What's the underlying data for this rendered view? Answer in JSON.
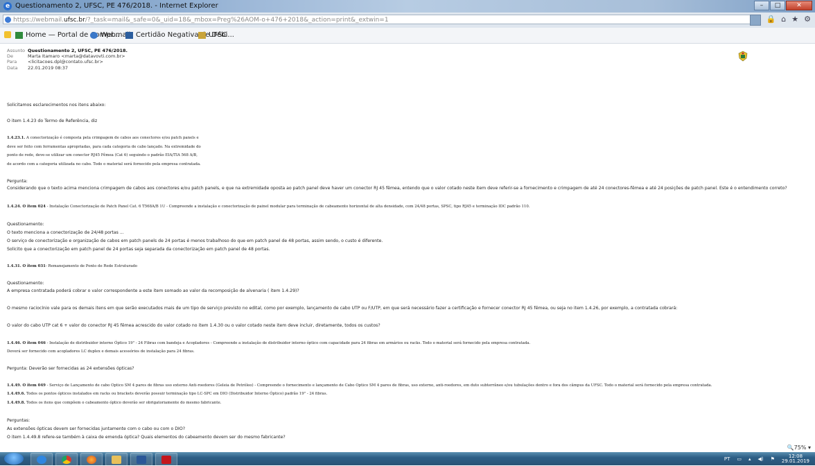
{
  "window": {
    "title": "Questionamento 2, UFSC, PE 476/2018. - Internet Explorer"
  },
  "address": {
    "scheme": "https://webmail.",
    "host": "ufsc.br",
    "rest": "/?_task=mail&_safe=0&_uid=18&_mbox=Preg%26AOM-o+476+2018&_action=print&_extwin=1"
  },
  "favorites": [
    {
      "label": "Home — Portal de Compr...",
      "icon": "portal-icon"
    },
    {
      "label": "Webmail",
      "icon": "webmail-icon"
    },
    {
      "label": "Certidão Negativa de Débi...",
      "icon": "certidao-icon"
    },
    {
      "label": "UFSC",
      "icon": "ufsc-icon"
    }
  ],
  "email": {
    "labels": {
      "subject": "Assunto",
      "from": "De",
      "to": "Para",
      "date": "Data"
    },
    "subject": "Questionamento 2, UFSC, PE 476/2018.",
    "from": "Marta Itamaro <marta@datavovti.com.br>",
    "to": "<licitacoes.dpl@contato.ufsc.br>",
    "date": "22.01.2019 08:37"
  },
  "body": {
    "l1": "Solicitamos esclarecimentos nos itens abaixo:",
    "l2": "O item 1.4.23 do Termo de Referência, diz",
    "q1a_num": "1.4.23.1.",
    "q1a": " A conectorização é composta pela crimpagem de cabos aos conectores e/ou patch panels e",
    "q1b": "deve ser feito com ferramentas apropriadas, para cada categoria de cabo lançado. Na extremidade do",
    "q1c": "ponto de rede, deve-se utilizar um conector RJ45 Fêmea (Cat 6) seguindo o padrão EIA/TIA 568 A/B,",
    "q1d": "de acordo com a categoria utilizada no cabo. Todo o material será fornecido pela empresa contratada.",
    "p1h": "Pergunta:",
    "p1": "Considerando que o texto acima menciona crimpagem de cabos aos conectores e/ou patch panels, e que na extremidade oposta ao patch panel deve haver um conector RJ 45 fêmea, entendo que o valor cotado neste item deve referir-se a fornecimento e crimpagem de até 24 conectores-fêmea e até 24 posições de patch panel. Este é o entendimento correto?",
    "q2_num": "1.4.24. O item 024",
    "q2": " - Instalação Conectorização de Patch Panel Cat. 6 T568A/B 1U - Compreende a instalação e conectorização de painel modular para terminação de cabeamento horizontal de alta densidade, com 24/48 portas, SPSC, tipo RJ45 e terminação IDC padrão 110.",
    "p2h": "Questionamento:",
    "p2a": "O texto menciona a conectorização de 24/48 portas ...",
    "p2b": "O serviço de conectorização e organização de cabos em patch panels de 24 portas é menos trabalhoso do que em patch panel de 48 portas, assim sendo, o custo é diferente.",
    "p2c": "Solicito que a conectorização em patch panel de 24 portas seja separada da conectorização em patch panel de 48 portas.",
    "q3_num": "1.4.31. O item 031",
    "q3": "- Remanejamento de Ponto de Rede Estruturado",
    "p3h": "Questionamento:",
    "p3a": "A empresa contratada poderá cobrar o valor correspondente a este item somado ao valor da recomposição de alvenaria ( item 1.4.29)?",
    "p3b": "O mesmo raciocínio vale para os demais itens em que serão executados mais de um tipo de serviço previsto no edital, como por exemplo, lançamento de cabo UTP ou F/UTP, em que será necessário fazer a certificação e fornecer conector RJ 45 fêmea, ou seja no item 1.4.26, por exemplo, a contratada cobrará:",
    "p3c": "O valor do cabo UTP cat 6 + valor do conector RJ 45 fêmea acrescido do valor cotado no item 1.4.30 ou o valor cotado neste item deve incluir, diretamente, todos os custos?",
    "q4_num": "1.4.46. O item 046",
    "q4a": " - Instalação de distribuidor interno Óptico 19\" - 24 Fibras com bandeja e Acopladores - Compreende a instalação de distribuidor interno óptico com capacidade para 24 fibras em armários ou racks. Todo o material será fornecido pela empresa contratada.",
    "q4b": "Deverá ser fornecido com acopladores LC duplex e demais acessórios de instalação para 24 fibras.",
    "p4": "Pergunta: Deverão ser fornecidas as 24 extensões ópticas?",
    "q5_num": "1.4.49. O item 049",
    "q5a": " - Serviço de Lançamento de cabo Optico SM 4 pares de fibras uso externo Anti-roedores (Geleia de Petróleo) - Compreende o fornecimento e lançamento de Cabo Optico SM 4 pares de fibras, uso externo, anti-roedores, em duto subterrâneo e/ou tubulações dentro e fora dos câmpus da UFSC. Todo o material será fornecido pela empresa contratada.",
    "q5b_num": "1.4.49.6.",
    "q5b": " Todos os pontos ópticos instalados em racks ou brackets deverão possuir terminação tipo LC-SPC em DIO (Distribuidor Interno Óptico) padrão 19\" - 24 fibras.",
    "q5c_num": "1.4.49.8.",
    "q5c": " Todos os itens que compõem o cabeamento óptico deverão ser obrigatoriamente do mesmo fabricante.",
    "p5h": "Perguntas:",
    "p5a": "As extensões ópticas devem ser fornecidas juntamente com o cabo ou com o DIO?",
    "p5b": "O item 1.4.49.8 refere-se também à caixa de emenda óptica? Quais elementos do cabeamento devem ser do mesmo fabricante?"
  },
  "status": {
    "zoom": "75%"
  },
  "taskbar": {
    "lang": "PT",
    "time": "12:08",
    "date": "29.01.2019"
  }
}
